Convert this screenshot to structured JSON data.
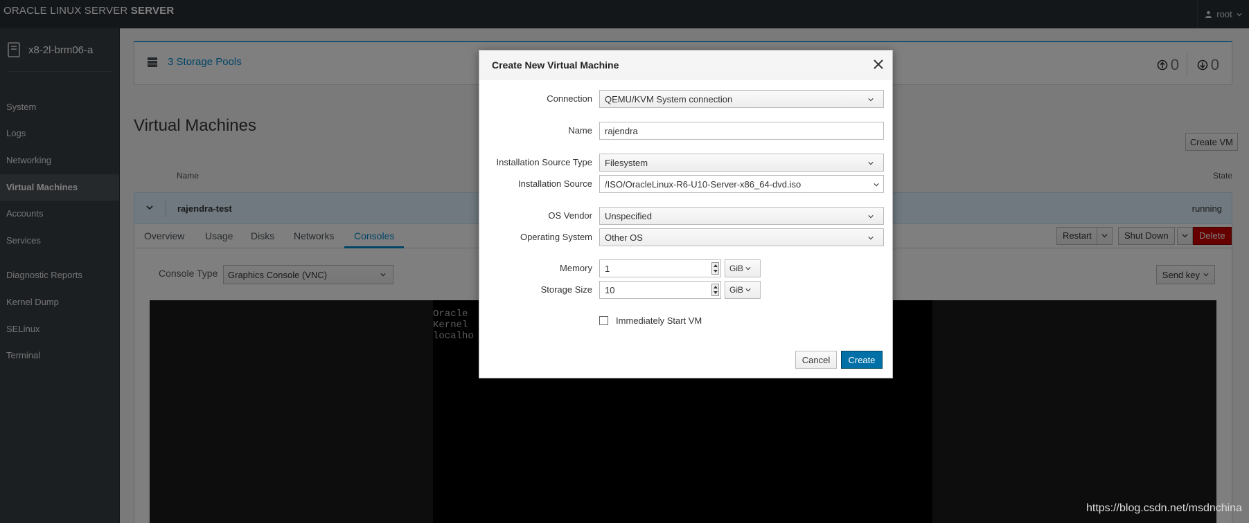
{
  "topbar": {
    "brand_light": "ORACLE LINUX SERVER ",
    "brand_bold": "SERVER",
    "user": "root"
  },
  "sidebar": {
    "host": "x8-2l-brm06-a",
    "items": [
      {
        "label": "System"
      },
      {
        "label": "Logs"
      },
      {
        "label": "Networking"
      },
      {
        "label": "Virtual Machines"
      },
      {
        "label": "Accounts"
      },
      {
        "label": "Services"
      },
      {
        "label": "Diagnostic Reports"
      },
      {
        "label": "Kernel Dump"
      },
      {
        "label": "SELinux"
      },
      {
        "label": "Terminal"
      }
    ],
    "active": "Virtual Machines"
  },
  "main": {
    "storage_count": "3",
    "storage_label": "Storage Pools",
    "net_up": "0",
    "net_down": "0",
    "title": "Virtual Machines",
    "create_vm": "Create VM",
    "col_name": "Name",
    "col_state": "State",
    "vm": {
      "name": "rajendra-test",
      "state": "running"
    },
    "tabs": [
      {
        "label": "Overview"
      },
      {
        "label": "Usage"
      },
      {
        "label": "Disks"
      },
      {
        "label": "Networks"
      },
      {
        "label": "Consoles"
      }
    ],
    "active_tab": "Consoles",
    "actions": {
      "restart": "Restart",
      "shutdown": "Shut Down",
      "delete": "Delete"
    },
    "console_type_label": "Console Type",
    "console_type_value": "Graphics Console (VNC)",
    "send_key": "Send key",
    "vnc_lines": [
      "Oracle",
      "Kernel",
      "",
      "localho"
    ]
  },
  "modal": {
    "title": "Create New Virtual Machine",
    "connection_label": "Connection",
    "connection_value": "QEMU/KVM System connection",
    "name_label": "Name",
    "name_value": "rajendra",
    "source_type_label": "Installation Source Type",
    "source_type_value": "Filesystem",
    "source_label": "Installation Source",
    "source_value": "/ISO/OracleLinux-R6-U10-Server-x86_64-dvd.iso",
    "os_vendor_label": "OS Vendor",
    "os_vendor_value": "Unspecified",
    "os_label": "Operating System",
    "os_value": "Other OS",
    "memory_label": "Memory",
    "memory_value": "1",
    "memory_unit": "GiB",
    "storage_label": "Storage Size",
    "storage_value": "10",
    "storage_unit": "GiB",
    "start_vm_label": "Immediately Start VM",
    "start_vm_checked": false,
    "cancel": "Cancel",
    "create": "Create"
  },
  "watermark": "https://blog.csdn.net/msdnchina",
  "colors": {
    "topbar": "#292e34",
    "sidebar": "#393f44",
    "accent": "#0088ce",
    "danger": "#cc0000",
    "primary_button": "#0070a6"
  }
}
